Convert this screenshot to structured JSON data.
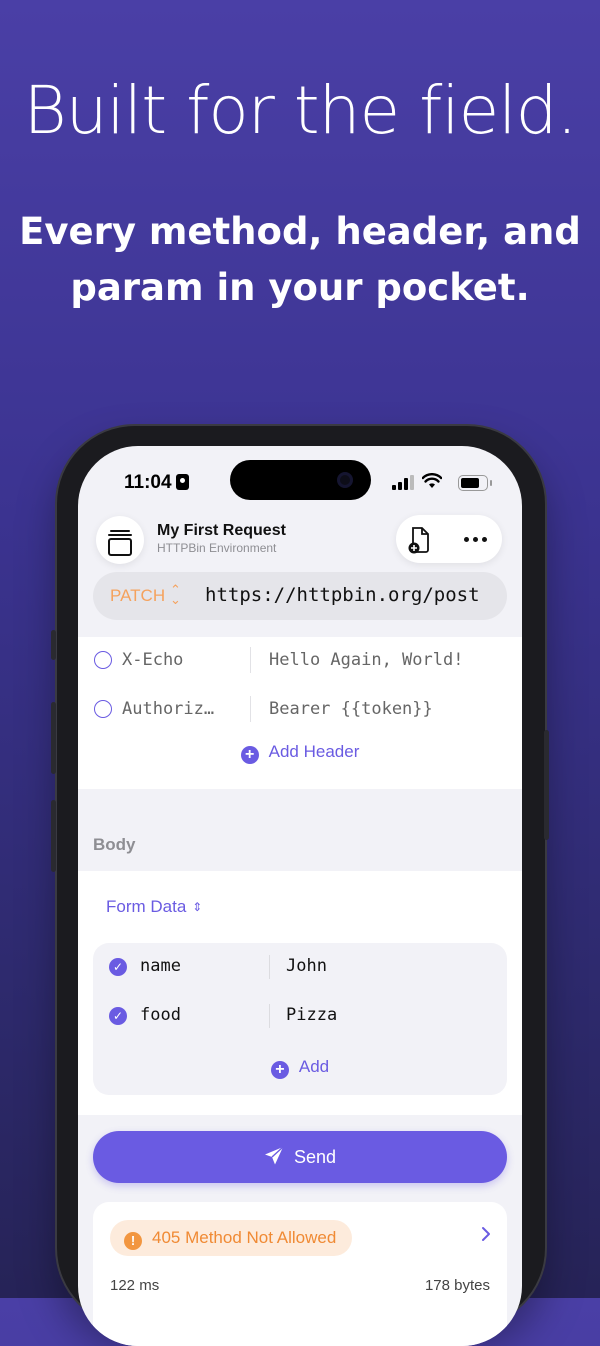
{
  "headline": "Built for the field.",
  "subline_1": "Every method, header, and",
  "subline_2": "param in your pocket.",
  "status_bar": {
    "time": "11:04"
  },
  "request": {
    "title": "My First Request",
    "environment": "HTTPBin Environment",
    "method": "PATCH",
    "url": "https://httpbin.org/post"
  },
  "headers": [
    {
      "key": "X-Echo",
      "value": "Hello Again, World!",
      "enabled": false
    },
    {
      "key": "Authoriz…",
      "value": "Bearer {{token}}",
      "enabled": false
    }
  ],
  "add_header_label": "Add Header",
  "body": {
    "section_label": "Body",
    "type_label": "Form Data",
    "params": [
      {
        "key": "name",
        "value": "John",
        "enabled": true
      },
      {
        "key": "food",
        "value": "Pizza",
        "enabled": true
      }
    ],
    "add_label": "Add"
  },
  "send_label": "Send",
  "response": {
    "status": "405 Method Not Allowed",
    "time": "122 ms",
    "size": "178 bytes"
  },
  "colors": {
    "accent": "#6a5be2",
    "method": "#f5a25d",
    "error": "#f08a34"
  }
}
